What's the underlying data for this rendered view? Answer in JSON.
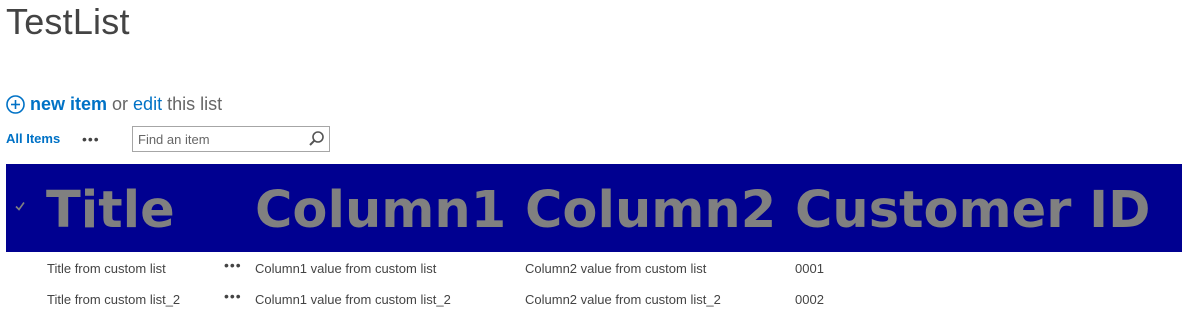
{
  "page": {
    "title": "TestList"
  },
  "quick_actions": {
    "new_item_label": "new item",
    "or_label": "or",
    "edit_label": "edit",
    "this_list_label": "this list"
  },
  "view_bar": {
    "current_view": "All Items",
    "more_views": "•••",
    "search": {
      "placeholder": "Find an item",
      "value": ""
    }
  },
  "list": {
    "colors": {
      "header_background": "#000090",
      "header_text": "#808080",
      "link_accent": "#0072c6"
    },
    "columns": [
      "Title",
      "Column1",
      "Column2",
      "Customer ID"
    ],
    "rows": [
      {
        "title": "Title from custom list",
        "ellipsis": "•••",
        "column1": "Column1 value from custom list",
        "column2": "Column2 value from custom list",
        "customer_id": "0001"
      },
      {
        "title": "Title from custom list_2",
        "ellipsis": "•••",
        "column1": "Column1 value from custom list_2",
        "column2": "Column2 value from custom list_2",
        "customer_id": "0002"
      }
    ]
  },
  "icons": {
    "add": "circle-plus-icon",
    "search": "magnifier-icon",
    "select_all": "checkmark-icon"
  }
}
